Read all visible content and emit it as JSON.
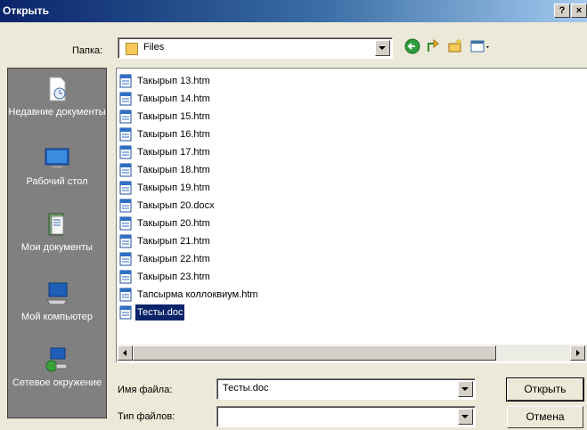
{
  "window": {
    "title": "Открыть",
    "help_button": "?",
    "close_button": "×"
  },
  "lookin": {
    "label": "Папка:",
    "value": "Files"
  },
  "toolbar": {
    "icons": [
      "back-arrow-icon",
      "up-one-level-icon",
      "new-folder-icon",
      "views-menu-icon"
    ]
  },
  "places": [
    {
      "label": "Недавние документы",
      "icon": "recent-documents-icon"
    },
    {
      "label": "Рабочий стол",
      "icon": "desktop-icon"
    },
    {
      "label": "Мои документы",
      "icon": "my-documents-icon"
    },
    {
      "label": "Мой компьютер",
      "icon": "my-computer-icon"
    },
    {
      "label": "Сетевое окружение",
      "icon": "network-places-icon"
    }
  ],
  "files": [
    {
      "name": "Такырып 13.htm"
    },
    {
      "name": "Такырып 14.htm"
    },
    {
      "name": "Такырып 15.htm"
    },
    {
      "name": "Такырып 16.htm"
    },
    {
      "name": "Такырып 17.htm"
    },
    {
      "name": "Такырып 18.htm"
    },
    {
      "name": "Такырып 19.htm"
    },
    {
      "name": "Такырып 20.docx"
    },
    {
      "name": "Такырып 20.htm"
    },
    {
      "name": "Такырып 21.htm"
    },
    {
      "name": "Такырып 22.htm"
    },
    {
      "name": "Такырып 23.htm"
    },
    {
      "name": "Тапсырма коллоквиум.htm"
    },
    {
      "name": "Тесты.doc",
      "selected": true
    }
  ],
  "filename": {
    "label": "Имя файла:",
    "value": "Тесты.doc"
  },
  "filetype": {
    "label": "Тип файлов:",
    "value": ""
  },
  "buttons": {
    "open": "Открыть",
    "cancel": "Отмена"
  },
  "colors": {
    "title_start": "#0a246a",
    "title_end": "#a6caf0",
    "dialog_bg": "#ece9d8",
    "selection": "#0a246a"
  }
}
